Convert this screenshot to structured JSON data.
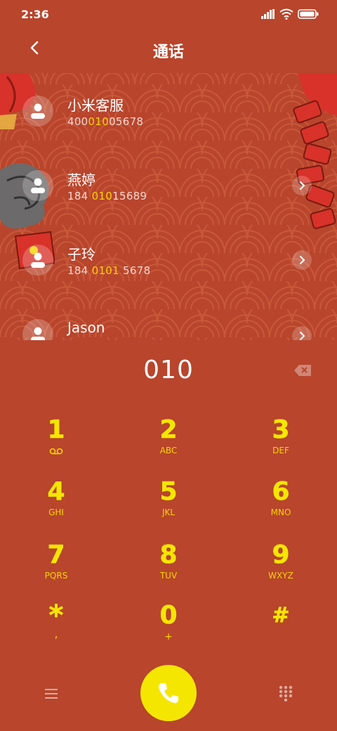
{
  "status": {
    "time": "2:36"
  },
  "header": {
    "title": "通话"
  },
  "contacts": [
    {
      "name": "小米客服",
      "num_pre": "400",
      "num_hl": "010",
      "num_post": "05678"
    },
    {
      "name": "燕婷",
      "num_pre": "184 ",
      "num_hl": "010",
      "num_post": "15689"
    },
    {
      "name": "子玲",
      "num_pre": "184 ",
      "num_hl": "0101",
      "num_post": " 5678"
    },
    {
      "name": "Jason",
      "num_pre": "",
      "num_hl": "",
      "num_post": ""
    }
  ],
  "dialer": {
    "input": "010",
    "keys": [
      {
        "digit": "1",
        "letters": ""
      },
      {
        "digit": "2",
        "letters": "ABC"
      },
      {
        "digit": "3",
        "letters": "DEF"
      },
      {
        "digit": "4",
        "letters": "GHI"
      },
      {
        "digit": "5",
        "letters": "JKL"
      },
      {
        "digit": "6",
        "letters": "MNO"
      },
      {
        "digit": "7",
        "letters": "PQRS"
      },
      {
        "digit": "8",
        "letters": "TUV"
      },
      {
        "digit": "9",
        "letters": "WXYZ"
      },
      {
        "digit": "*",
        "letters": ","
      },
      {
        "digit": "0",
        "letters": "+"
      },
      {
        "digit": "#",
        "letters": ""
      }
    ]
  },
  "colors": {
    "background": "#b8452c",
    "accent": "#f5e600",
    "highlight": "#f5d400"
  },
  "icons": {
    "back": "chevron-left-icon",
    "voicemail": "voicemail-icon",
    "backspace": "backspace-icon",
    "menu": "menu-icon",
    "call": "phone-icon",
    "keypad": "keypad-icon"
  }
}
